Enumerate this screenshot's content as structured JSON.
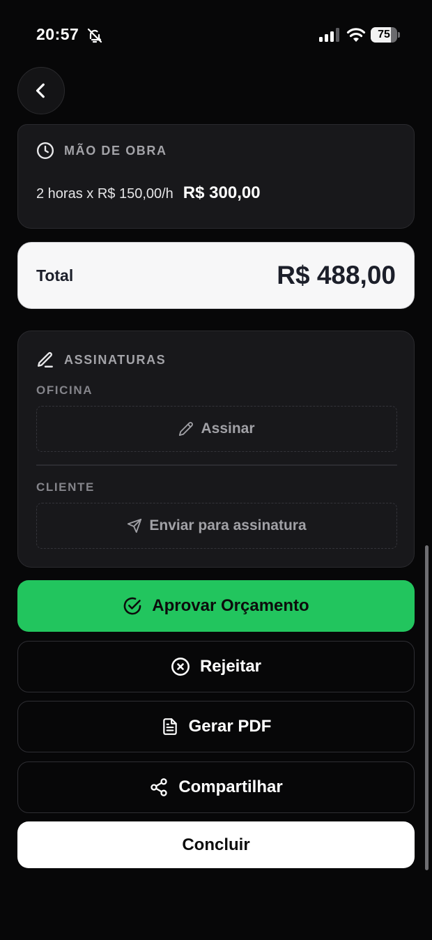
{
  "status_bar": {
    "time": "20:57",
    "battery_level": "75",
    "battery_fraction": 0.75,
    "icons": [
      "bell-slash-icon",
      "signal-icon",
      "wifi-icon",
      "battery-icon"
    ]
  },
  "nav": {
    "back_icon": "chevron-left-icon"
  },
  "labor": {
    "title": "MÃO DE OBRA",
    "icon": "clock-icon",
    "description": "2 horas x R$ 150,00/h",
    "amount": "R$ 300,00"
  },
  "total": {
    "label": "Total",
    "value": "R$ 488,00"
  },
  "signatures": {
    "title": "ASSINATURAS",
    "icon": "pen-icon",
    "workshop": {
      "label": "OFICINA",
      "action": "Assinar",
      "icon": "pencil-icon"
    },
    "client": {
      "label": "CLIENTE",
      "action": "Enviar para assinatura",
      "icon": "send-icon"
    }
  },
  "actions": {
    "approve": {
      "label": "Aprovar Orçamento",
      "icon": "check-circle-icon",
      "color": "#22c55e"
    },
    "reject": {
      "label": "Rejeitar",
      "icon": "x-circle-icon"
    },
    "pdf": {
      "label": "Gerar PDF",
      "icon": "file-text-icon"
    },
    "share": {
      "label": "Compartilhar",
      "icon": "share-icon"
    },
    "done": {
      "label": "Concluir"
    }
  }
}
